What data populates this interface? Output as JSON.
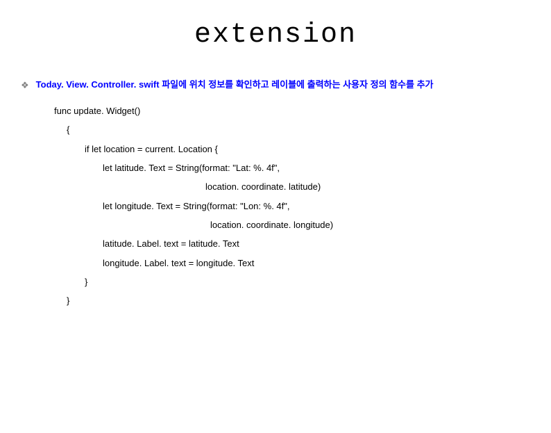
{
  "title": "extension",
  "heading": "Today. View. Controller. swift 파일에 위치 정보를 확인하고 레이블에 출력하는 사용자 정의 함수를 추가",
  "code": {
    "l1": "func update. Widget()",
    "l2": "{",
    "l3": "if let location = current. Location {",
    "l4": "let latitude. Text = String(format: \"Lat: %. 4f\",",
    "l5": "location. coordinate. latitude)",
    "l6": "",
    "l7": "let longitude. Text = String(format: \"Lon: %. 4f\",",
    "l8": "location. coordinate. longitude)",
    "l9": "",
    "l10": "latitude. Label. text = latitude. Text",
    "l11": "longitude. Label. text = longitude. Text",
    "l12": "}",
    "l13": "}"
  }
}
